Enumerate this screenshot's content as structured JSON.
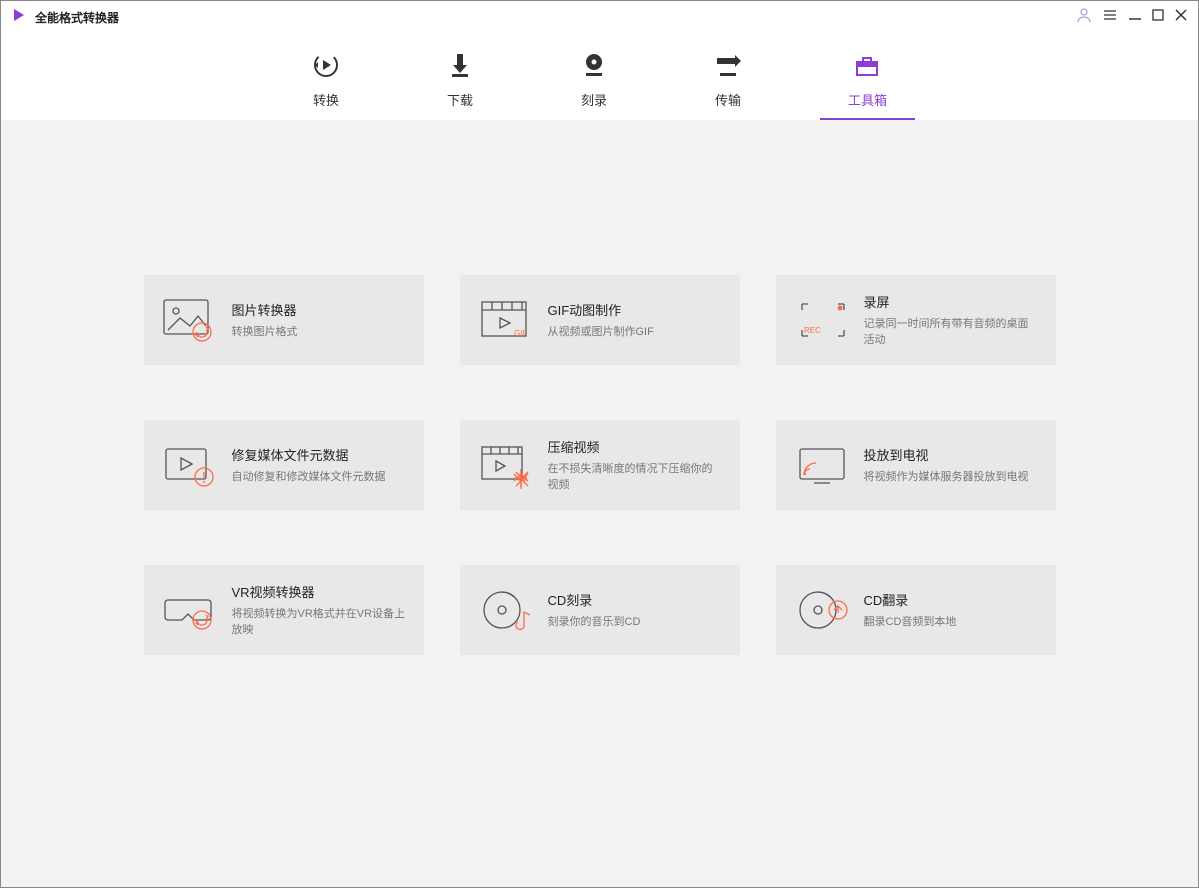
{
  "app": {
    "title": "全能格式转换器"
  },
  "nav": {
    "items": [
      {
        "label": "转换"
      },
      {
        "label": "下载"
      },
      {
        "label": "刻录"
      },
      {
        "label": "传输"
      },
      {
        "label": "工具箱"
      }
    ],
    "active_index": 4
  },
  "tools": [
    {
      "title": "图片转换器",
      "desc": "转换图片格式"
    },
    {
      "title": "GIF动图制作",
      "desc": "从视频或图片制作GIF"
    },
    {
      "title": "录屏",
      "desc": "记录同一时间所有带有音频的桌面活动"
    },
    {
      "title": "修复媒体文件元数据",
      "desc": "自动修复和修改媒体文件元数据"
    },
    {
      "title": "压缩视频",
      "desc": "在不损失清晰度的情况下压缩你的视频"
    },
    {
      "title": "投放到电视",
      "desc": "将视频作为媒体服务器投放到电视"
    },
    {
      "title": "VR视频转换器",
      "desc": "将视频转换为VR格式并在VR设备上放映"
    },
    {
      "title": "CD刻录",
      "desc": "刻录你的音乐到CD"
    },
    {
      "title": "CD翻录",
      "desc": "翻录CD音频到本地"
    }
  ]
}
